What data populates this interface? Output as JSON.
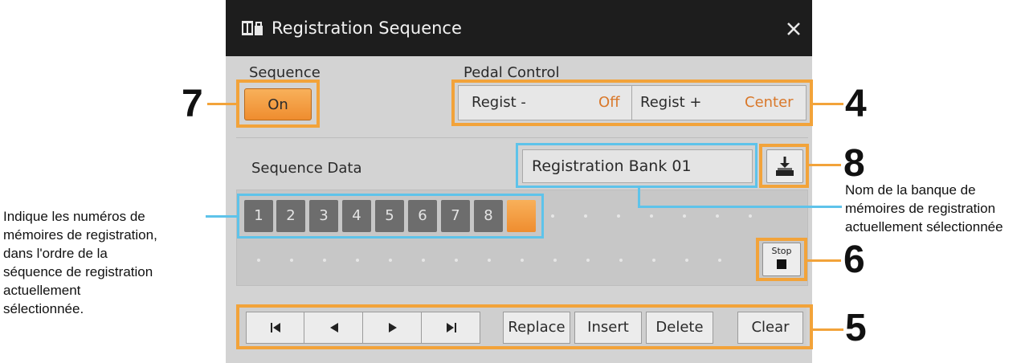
{
  "window": {
    "title": "Registration Sequence",
    "title_icon": "registration-bank-icon",
    "close_icon": "close-icon"
  },
  "sequence": {
    "label": "Sequence",
    "value": "On"
  },
  "pedal_control": {
    "label": "Pedal Control",
    "minus": {
      "label": "Regist -",
      "value": "Off"
    },
    "plus": {
      "label": "Regist +",
      "value": "Center"
    }
  },
  "sequence_data": {
    "label": "Sequence Data",
    "bank_name": "Registration Bank 01",
    "load_icon": "download-icon",
    "cells": [
      "1",
      "2",
      "3",
      "4",
      "5",
      "6",
      "7",
      "8"
    ],
    "stop_label": "Stop"
  },
  "toolbar": {
    "nav_icons": [
      "skip-to-start-icon",
      "step-back-icon",
      "step-forward-icon",
      "skip-to-end-icon"
    ],
    "replace": "Replace",
    "insert": "Insert",
    "delete": "Delete",
    "clear": "Clear"
  },
  "annotations": {
    "n7": "7",
    "n4": "4",
    "n8": "8",
    "n6": "6",
    "n5": "5",
    "note_right": [
      "Nom de la banque de",
      "mémoires de registration",
      "actuellement sélectionnée"
    ],
    "note_left": [
      "Indique les numéros de",
      "mémoires de registration,",
      "dans l'ordre de la",
      "séquence de registration",
      "actuellement",
      "sélectionnée."
    ]
  },
  "colors": {
    "accent_orange": "#ef8d2f",
    "annotation_orange": "#f2a33a",
    "annotation_blue": "#5ec3ea",
    "title_bar": "#1d1d1d"
  }
}
